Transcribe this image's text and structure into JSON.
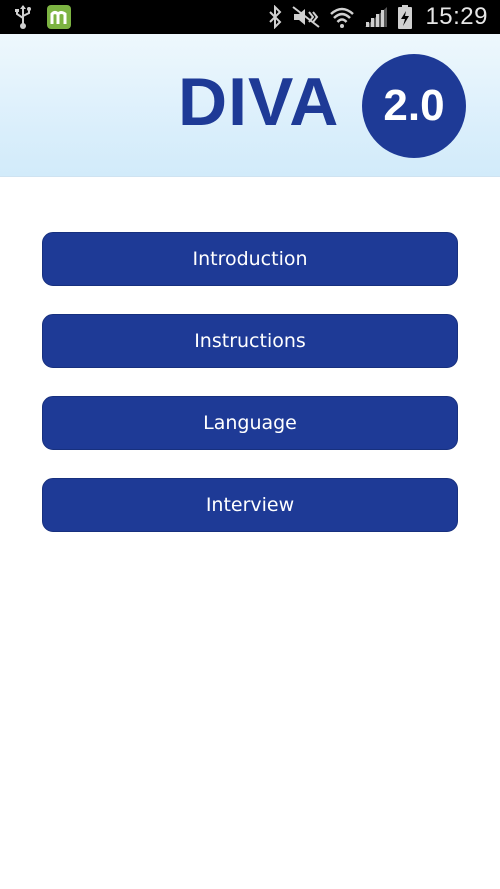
{
  "status_bar": {
    "time": "15:29",
    "icons": [
      "usb-icon",
      "app-notification-icon",
      "bluetooth-icon",
      "mute-vibrate-icon",
      "wifi-icon",
      "cell-signal-icon",
      "battery-charging-icon"
    ]
  },
  "header": {
    "logo_text": "DIVA",
    "logo_badge": "2.0",
    "brand_color": "#1e3a96"
  },
  "menu": {
    "items": [
      {
        "label": "Introduction"
      },
      {
        "label": "Instructions"
      },
      {
        "label": "Language"
      },
      {
        "label": "Interview"
      }
    ]
  }
}
